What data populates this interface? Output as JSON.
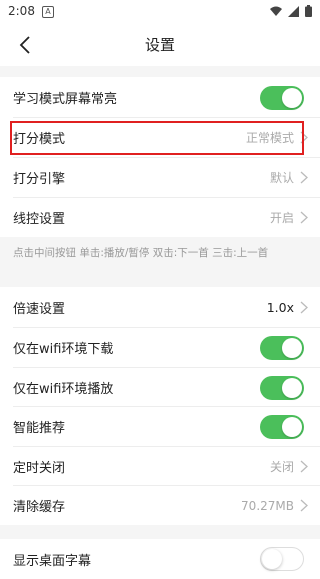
{
  "status_bar": {
    "time": "2:08",
    "badge": "A"
  },
  "nav": {
    "title": "设置",
    "back_icon": "chevron-left-icon"
  },
  "settings_group1": [
    {
      "label": "学习模式屏幕常亮",
      "type": "toggle",
      "on": true
    },
    {
      "label": "打分模式",
      "type": "value",
      "value": "正常模式"
    },
    {
      "label": "打分引擎",
      "type": "value",
      "value": "默认"
    },
    {
      "label": "线控设置",
      "type": "value",
      "value": "开启"
    }
  ],
  "hint_text": "点击中间按钮 单击:播放/暂停 双击:下一首 三击:上一首",
  "settings_group2": [
    {
      "label": "倍速设置",
      "type": "value",
      "value": "1.0x"
    },
    {
      "label": "仅在wifi环境下载",
      "type": "toggle",
      "on": true
    },
    {
      "label": "仅在wifi环境播放",
      "type": "toggle",
      "on": true
    },
    {
      "label": "智能推荐",
      "type": "toggle",
      "on": true
    },
    {
      "label": "定时关闭",
      "type": "value",
      "value": "关闭"
    },
    {
      "label": "清除缓存",
      "type": "value",
      "value": "70.27MB"
    }
  ],
  "settings_group3": [
    {
      "label": "显示桌面字幕",
      "type": "toggle",
      "on": false
    }
  ],
  "colors": {
    "toggle_on": "#4bbf5b",
    "highlight": "#e02020",
    "section_bg": "#f5f5f5"
  }
}
